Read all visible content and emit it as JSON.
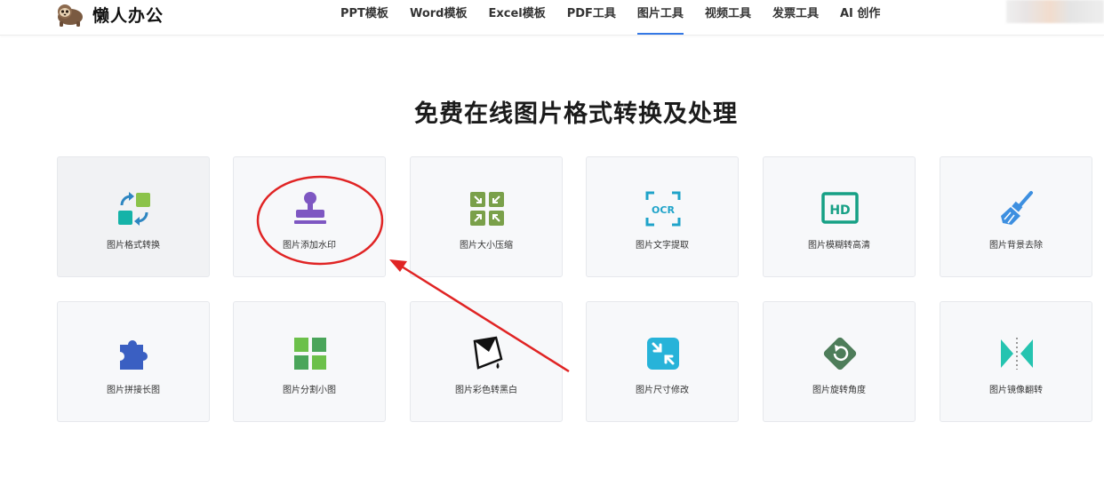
{
  "header": {
    "logo_text": "懒人办公",
    "nav": [
      {
        "label": "PPT模板",
        "active": false
      },
      {
        "label": "Word模板",
        "active": false
      },
      {
        "label": "Excel模板",
        "active": false
      },
      {
        "label": "PDF工具",
        "active": false
      },
      {
        "label": "图片工具",
        "active": true
      },
      {
        "label": "视频工具",
        "active": false
      },
      {
        "label": "发票工具",
        "active": false
      },
      {
        "label": "AI 创作",
        "active": false
      }
    ]
  },
  "main": {
    "title": "免费在线图片格式转换及处理",
    "tools": [
      {
        "label": "图片格式转换",
        "icon": "format-convert-icon"
      },
      {
        "label": "图片添加水印",
        "icon": "watermark-stamp-icon"
      },
      {
        "label": "图片大小压缩",
        "icon": "compress-icon"
      },
      {
        "label": "图片文字提取",
        "icon": "ocr-icon"
      },
      {
        "label": "图片模糊转高清",
        "icon": "hd-icon"
      },
      {
        "label": "图片背景去除",
        "icon": "broom-icon"
      },
      {
        "label": "图片拼接长图",
        "icon": "puzzle-icon"
      },
      {
        "label": "图片分割小图",
        "icon": "grid-split-icon"
      },
      {
        "label": "图片彩色转黑白",
        "icon": "paint-bucket-icon"
      },
      {
        "label": "图片尺寸修改",
        "icon": "resize-icon"
      },
      {
        "label": "图片旋转角度",
        "icon": "rotate-icon"
      },
      {
        "label": "图片镜像翻转",
        "icon": "mirror-flip-icon"
      }
    ]
  },
  "colors": {
    "accent": "#3478e5",
    "annotation": "#e02424"
  }
}
